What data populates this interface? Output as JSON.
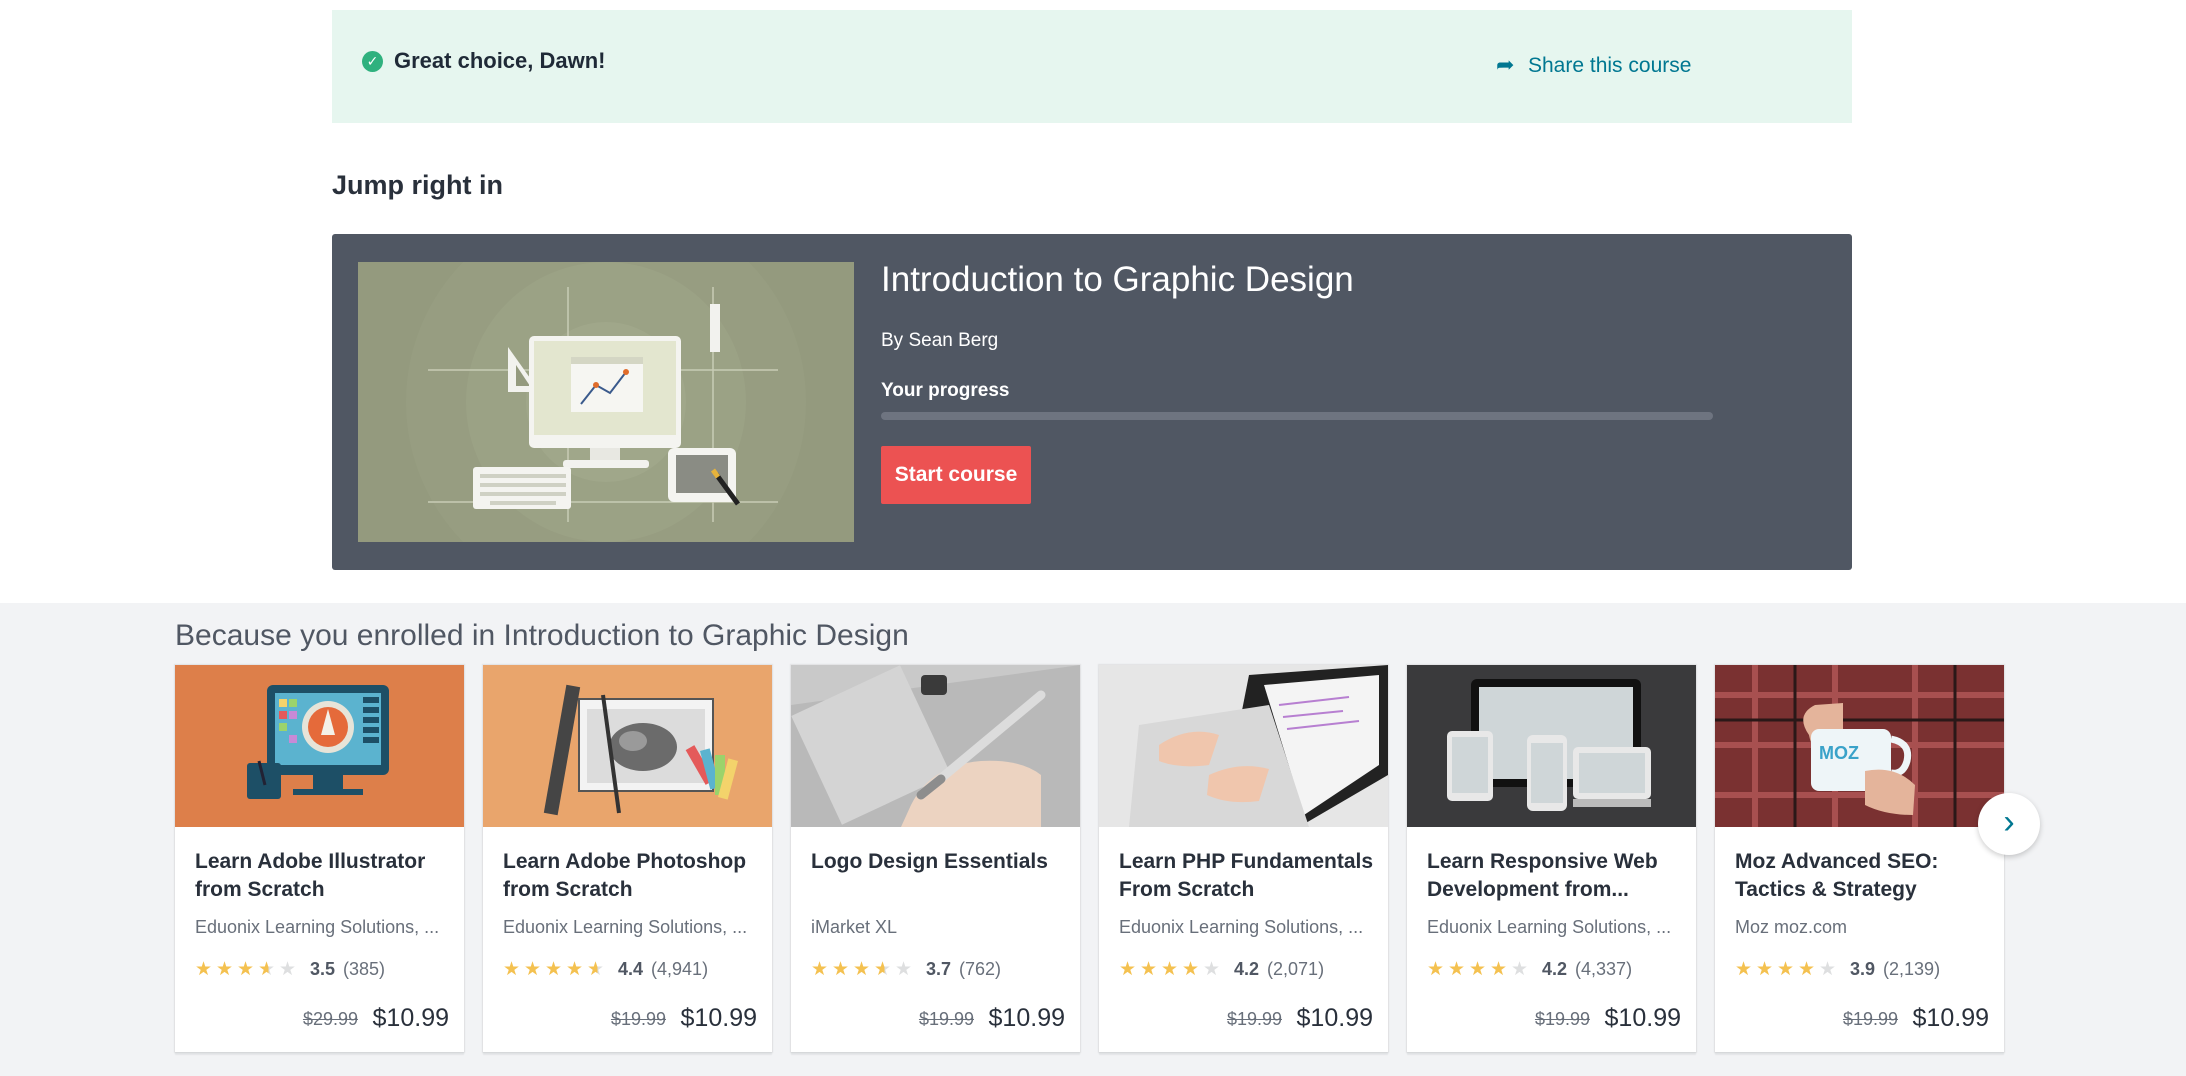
{
  "banner": {
    "message": "Great choice, Dawn!",
    "share_label": "Share this course"
  },
  "jump": {
    "heading": "Jump right in"
  },
  "course": {
    "title": "Introduction to Graphic Design",
    "author": "By Sean Berg",
    "progress_label": "Your progress",
    "progress": 0,
    "start_label": "Start course"
  },
  "recommendations": {
    "heading": "Because you enrolled in Introduction to Graphic Design",
    "cards": [
      {
        "title": "Learn Adobe Illustrator from Scratch",
        "author": "Eduonix Learning Solutions, ...",
        "rating": "3.5",
        "count": "(385)",
        "old_price": "$29.99",
        "price": "$10.99",
        "stars": 3.5,
        "image": "illustrator-monitor"
      },
      {
        "title": "Learn Adobe Photoshop from Scratch",
        "author": "Eduonix Learning Solutions, ...",
        "rating": "4.4",
        "count": "(4,941)",
        "old_price": "$19.99",
        "price": "$10.99",
        "stars": 4.5,
        "image": "photoshop-tools"
      },
      {
        "title": "Logo Design Essentials",
        "author": "iMarket XL",
        "rating": "3.7",
        "count": "(762)",
        "old_price": "$19.99",
        "price": "$10.99",
        "stars": 3.5,
        "image": "pen-tablet"
      },
      {
        "title": "Learn PHP Fundamentals From Scratch",
        "author": "Eduonix Learning Solutions, ...",
        "rating": "4.2",
        "count": "(2,071)",
        "old_price": "$19.99",
        "price": "$10.99",
        "stars": 4,
        "image": "laptop-typing"
      },
      {
        "title": "Learn Responsive Web Development from...",
        "author": "Eduonix Learning Solutions, ...",
        "rating": "4.2",
        "count": "(4,337)",
        "old_price": "$19.99",
        "price": "$10.99",
        "stars": 4,
        "image": "responsive-devices"
      },
      {
        "title": "Moz Advanced SEO: Tactics & Strategy",
        "author": "Moz moz.com",
        "rating": "3.9",
        "count": "(2,139)",
        "old_price": "$19.99",
        "price": "$10.99",
        "stars": 4,
        "image": "moz-mug"
      }
    ]
  },
  "carousel": {
    "next_icon": "chevron-right-icon"
  },
  "colors": {
    "accent": "#007791",
    "cta": "#ec5252",
    "star": "#f4c150",
    "banner_bg": "#e6f6ef",
    "course_bg": "#505763"
  }
}
